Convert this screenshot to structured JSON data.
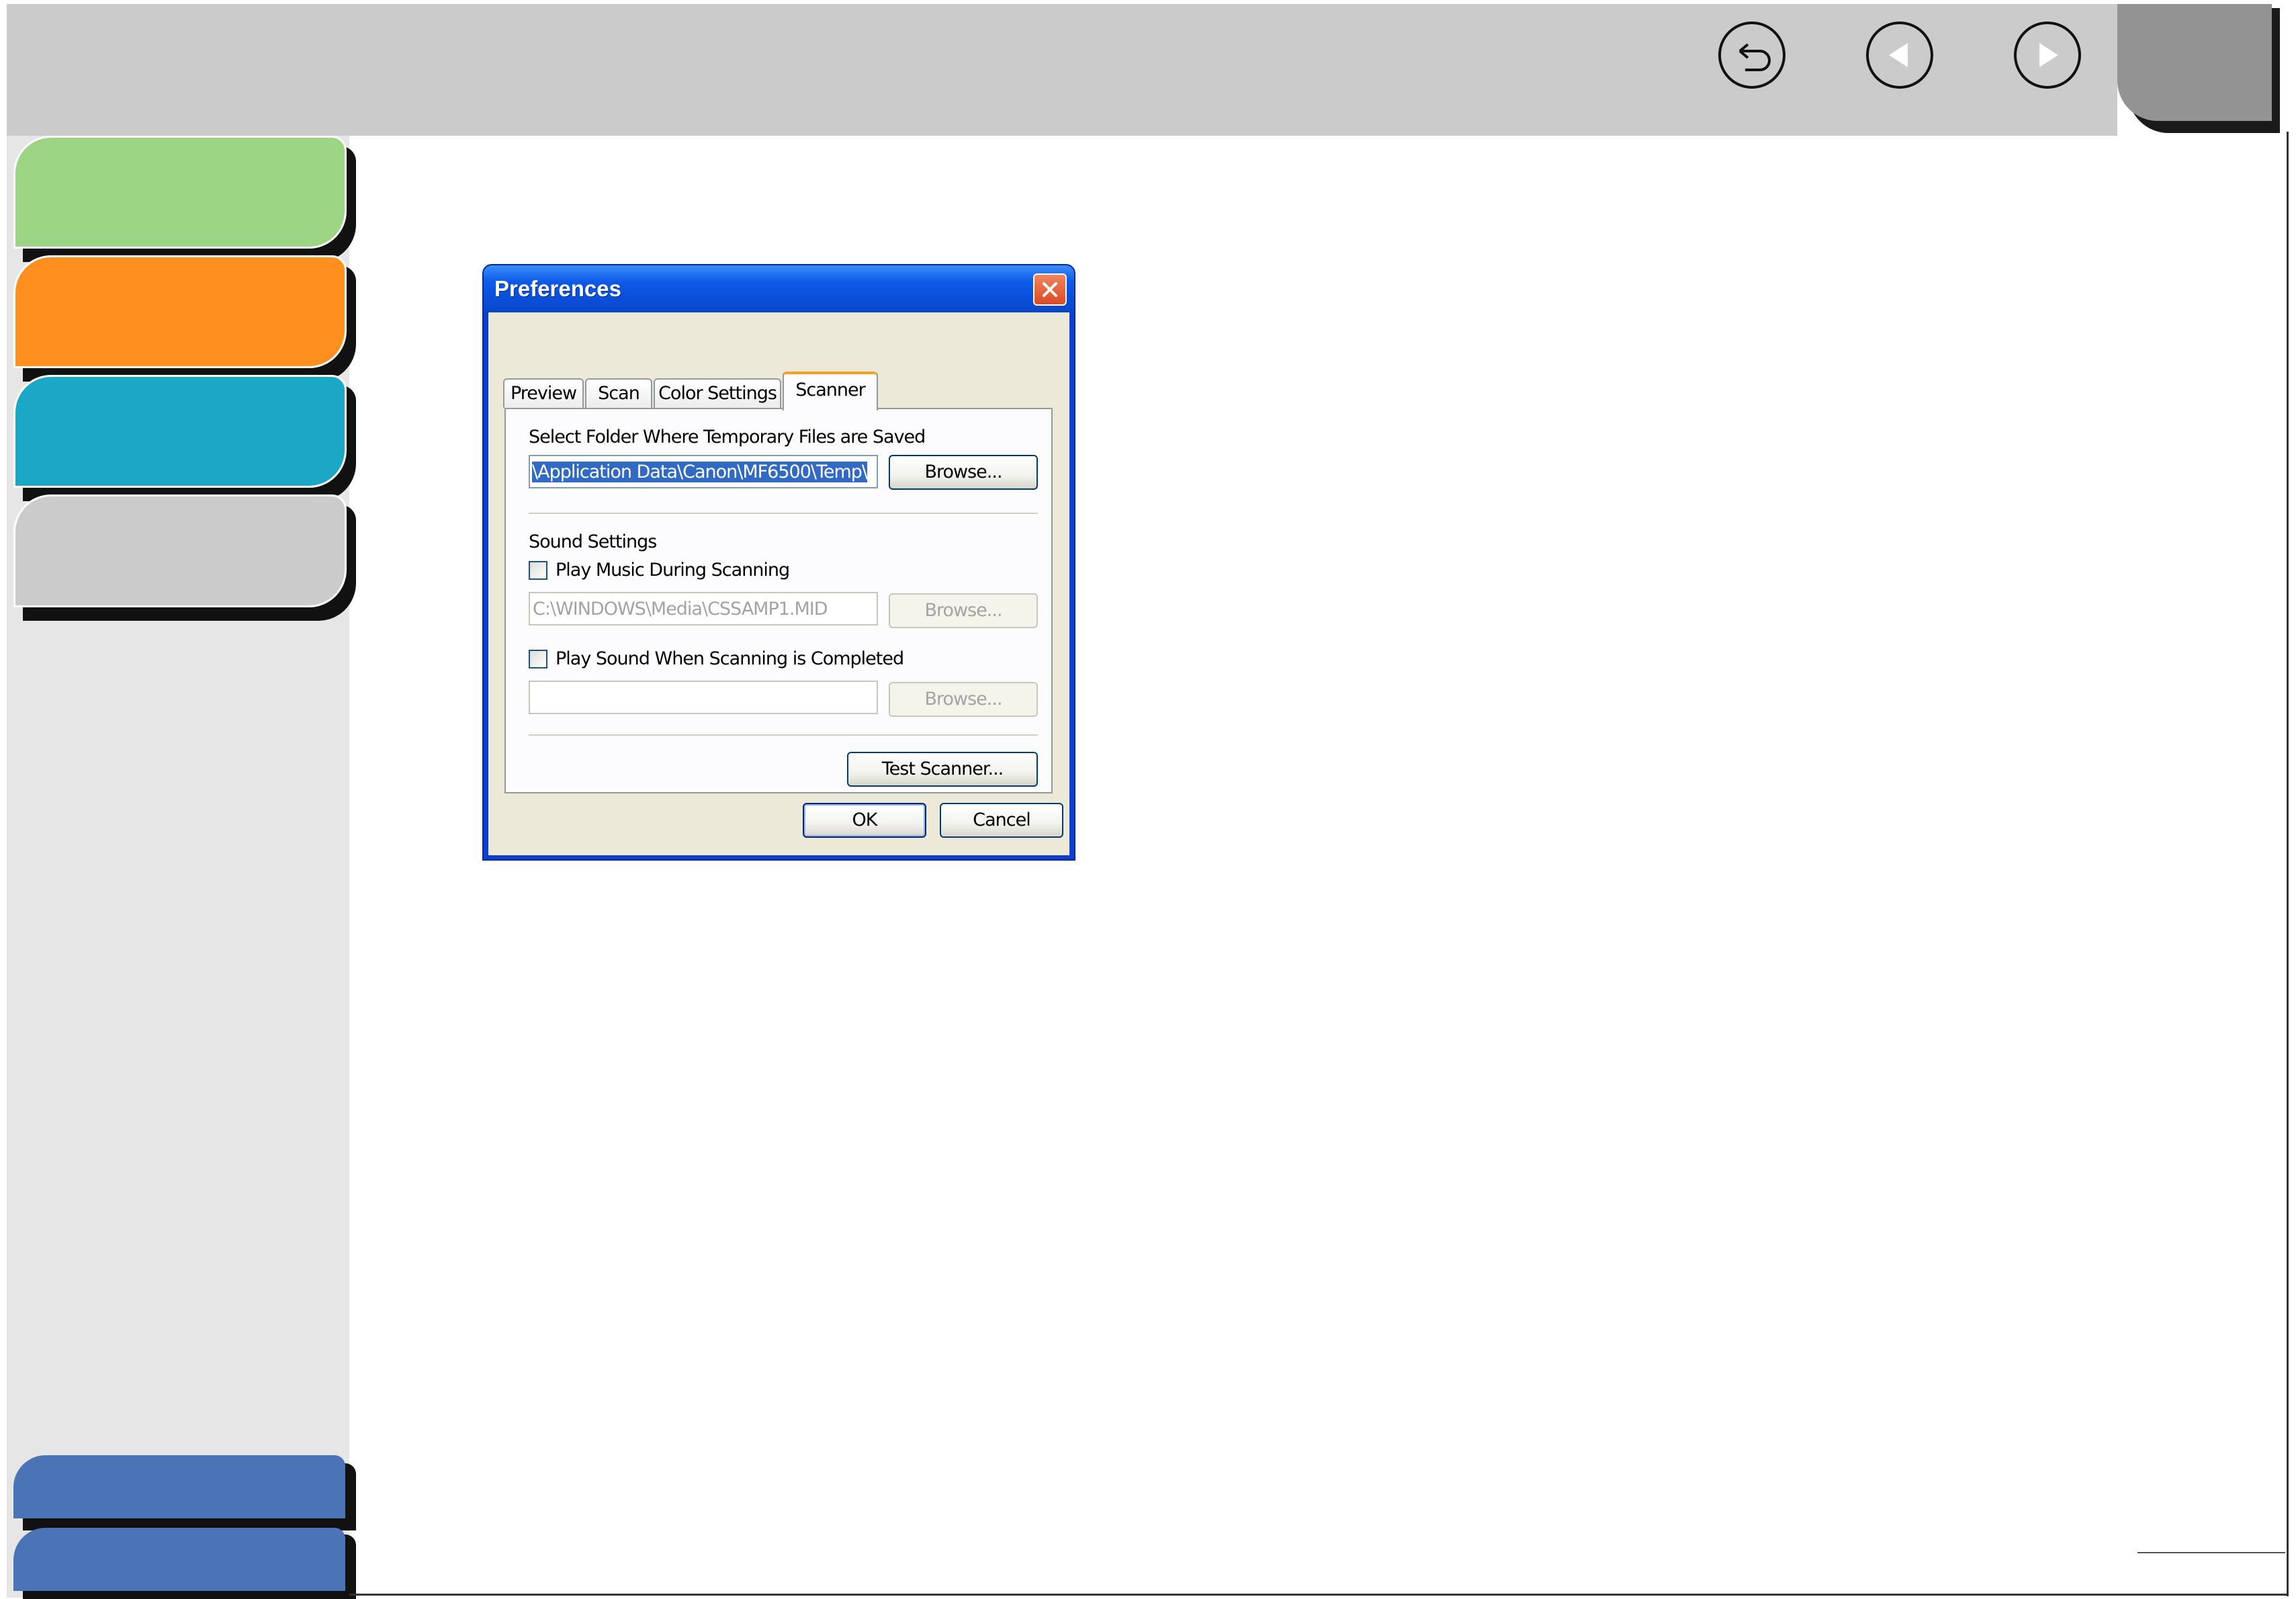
{
  "colors": {
    "topbar": "#cbcbcb",
    "sidebar": "#e6e6e6",
    "tab_green": "#9bd483",
    "tab_orange": "#ff8f1f",
    "tab_teal": "#1ba8c6",
    "tab_gray": "#cbcbcb",
    "tab_blue": "#4a74b6",
    "xp_title_blue": "#0a4fd8",
    "xp_face": "#ece9d8"
  },
  "nav": {
    "back_icon": "return-arrow-icon",
    "prev_icon": "triangle-left-icon",
    "next_icon": "triangle-right-icon"
  },
  "dialog": {
    "title": "Preferences",
    "close_icon": "close-x-icon",
    "tabs": [
      {
        "label": "Preview"
      },
      {
        "label": "Scan"
      },
      {
        "label": "Color Settings"
      },
      {
        "label": "Scanner",
        "selected": true
      }
    ],
    "temp_folder": {
      "label": "Select Folder Where Temporary Files are Saved",
      "path": "\\Application Data\\Canon\\MF6500\\Temp\\",
      "browse_label": "Browse..."
    },
    "sound": {
      "heading": "Sound Settings",
      "music": {
        "label": "Play Music During Scanning",
        "checked": false,
        "path": "C:\\WINDOWS\\Media\\CSSAMP1.MID",
        "browse_label": "Browse..."
      },
      "completed": {
        "label": "Play Sound When Scanning is Completed",
        "checked": false,
        "path": "",
        "browse_label": "Browse..."
      }
    },
    "test_scanner_label": "Test Scanner...",
    "ok_label": "OK",
    "cancel_label": "Cancel"
  }
}
